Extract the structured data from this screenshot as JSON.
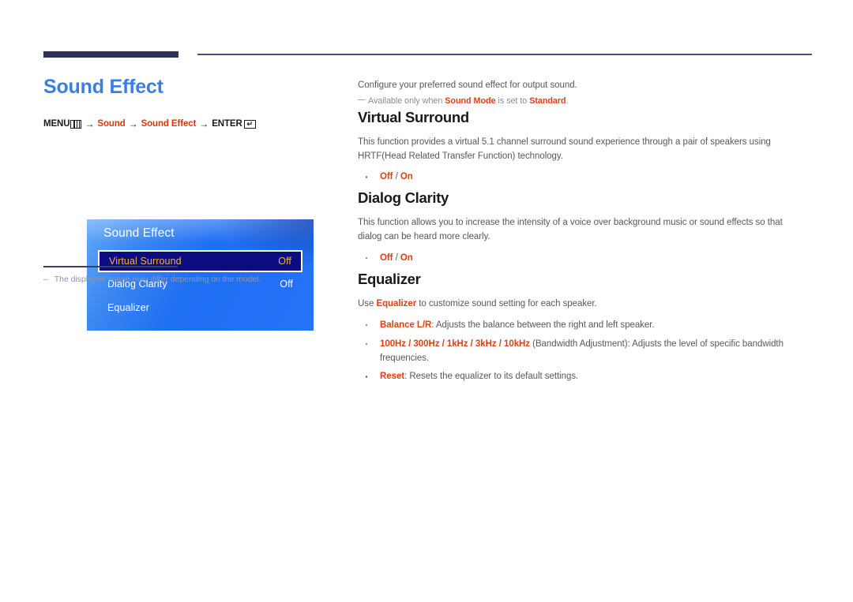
{
  "page": {
    "title": "Sound Effect"
  },
  "breadcrumb": {
    "menu_label": "MENU",
    "menu_icon": "menu-bars-icon",
    "arrow": "→",
    "sound_label": "Sound",
    "sound_effect_label": "Sound Effect",
    "enter_label": "ENTER",
    "enter_icon": "enter-return-icon",
    "enter_glyph": "↵"
  },
  "osd": {
    "title": "Sound Effect",
    "rows": [
      {
        "label": "Virtual Surround",
        "value": "Off",
        "selected": true
      },
      {
        "label": "Dialog Clarity",
        "value": "Off",
        "selected": false
      },
      {
        "label": "Equalizer",
        "value": "",
        "selected": false
      }
    ]
  },
  "image_footnote": {
    "dash": "–",
    "text": "The displayed image may differ depending on the model."
  },
  "content": {
    "intro": "Configure your preferred sound effect for output sound.",
    "note": {
      "before": "Available only when ",
      "bold1": "Sound Mode",
      "middle": " is set to ",
      "bold2": "Standard",
      "after": "."
    },
    "sections": [
      {
        "heading": "Virtual Surround",
        "paragraph": "This function provides a virtual 5.1 channel surround sound experience through a pair of speakers using HRTF(Head Related Transfer Function) technology.",
        "option_off": "Off",
        "option_sep": " / ",
        "option_on": "On"
      },
      {
        "heading": "Dialog Clarity",
        "paragraph": "This function allows you to increase the intensity of a voice over background music or sound effects so that dialog can be heard more clearly.",
        "option_off": "Off",
        "option_sep": " / ",
        "option_on": "On"
      },
      {
        "heading": "Equalizer",
        "lead_before": "Use ",
        "lead_bold": "Equalizer",
        "lead_after": " to customize sound setting for each speaker.",
        "bullets": [
          {
            "term": "Balance L/R",
            "desc": ": Adjusts the balance between the right and left speaker."
          },
          {
            "term": "100Hz / 300Hz / 1kHz / 3kHz / 10kHz",
            "desc": " (Bandwidth Adjustment): Adjusts the level of specific bandwidth frequencies."
          },
          {
            "term": "Reset",
            "desc": ": Resets the equalizer to its default settings."
          }
        ]
      }
    ]
  },
  "colors": {
    "title_blue": "#3c7ee0",
    "accent_red": "#e03e14",
    "rule_navy": "#2e3254",
    "osd_selected_bg": "#0b0b82",
    "osd_selected_text": "#f0b23c",
    "footnote_gray": "#8d93ad"
  }
}
